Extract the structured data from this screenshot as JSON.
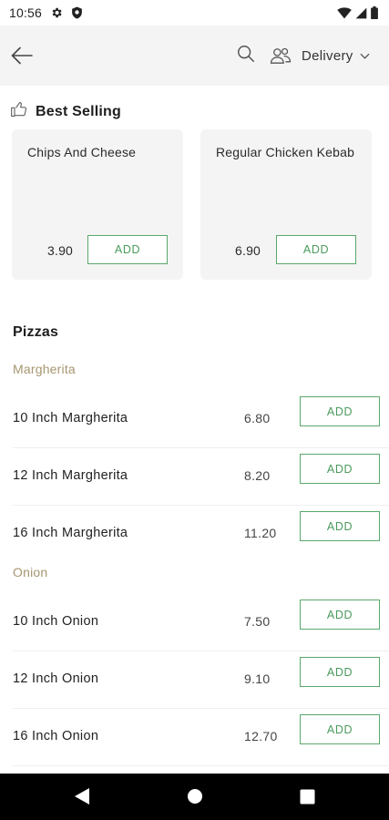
{
  "status_bar": {
    "time": "10:56",
    "icons": [
      "gear-icon",
      "shield-icon",
      "wifi-icon",
      "signal-icon",
      "battery-icon"
    ]
  },
  "app_bar": {
    "icons": [
      "back-arrow-icon",
      "search-icon",
      "users-icon",
      "chevron-down-icon"
    ],
    "delivery_label": "Delivery"
  },
  "best_selling": {
    "icon": "thumbs-up-icon",
    "title": "Best Selling",
    "items": [
      {
        "name": "Chips And Cheese",
        "price": "3.90",
        "add_label": "ADD"
      },
      {
        "name": "Regular Chicken Kebab",
        "price": "6.90",
        "add_label": "ADD"
      }
    ]
  },
  "menu": {
    "section_title": "Pizzas",
    "categories": [
      {
        "label": "Margherita",
        "items": [
          {
            "name": "10 Inch Margherita",
            "price": "6.80",
            "add_label": "ADD"
          },
          {
            "name": "12 Inch Margherita",
            "price": "8.20",
            "add_label": "ADD"
          },
          {
            "name": "16 Inch Margherita",
            "price": "11.20",
            "add_label": "ADD"
          }
        ]
      },
      {
        "label": "Onion",
        "items": [
          {
            "name": "10 Inch Onion",
            "price": "7.50",
            "add_label": "ADD"
          },
          {
            "name": "12 Inch Onion",
            "price": "9.10",
            "add_label": "ADD"
          },
          {
            "name": "16 Inch Onion",
            "price": "12.70",
            "add_label": "ADD"
          }
        ]
      }
    ]
  },
  "nav_bar": {
    "icons": [
      "back-triangle-icon",
      "home-circle-icon",
      "recents-square-icon"
    ]
  },
  "colors": {
    "accent_green": "#4a9a5c",
    "category_label": "#a6966f",
    "card_background": "#f4f4f4",
    "app_bar_background": "#f4f4f4"
  }
}
